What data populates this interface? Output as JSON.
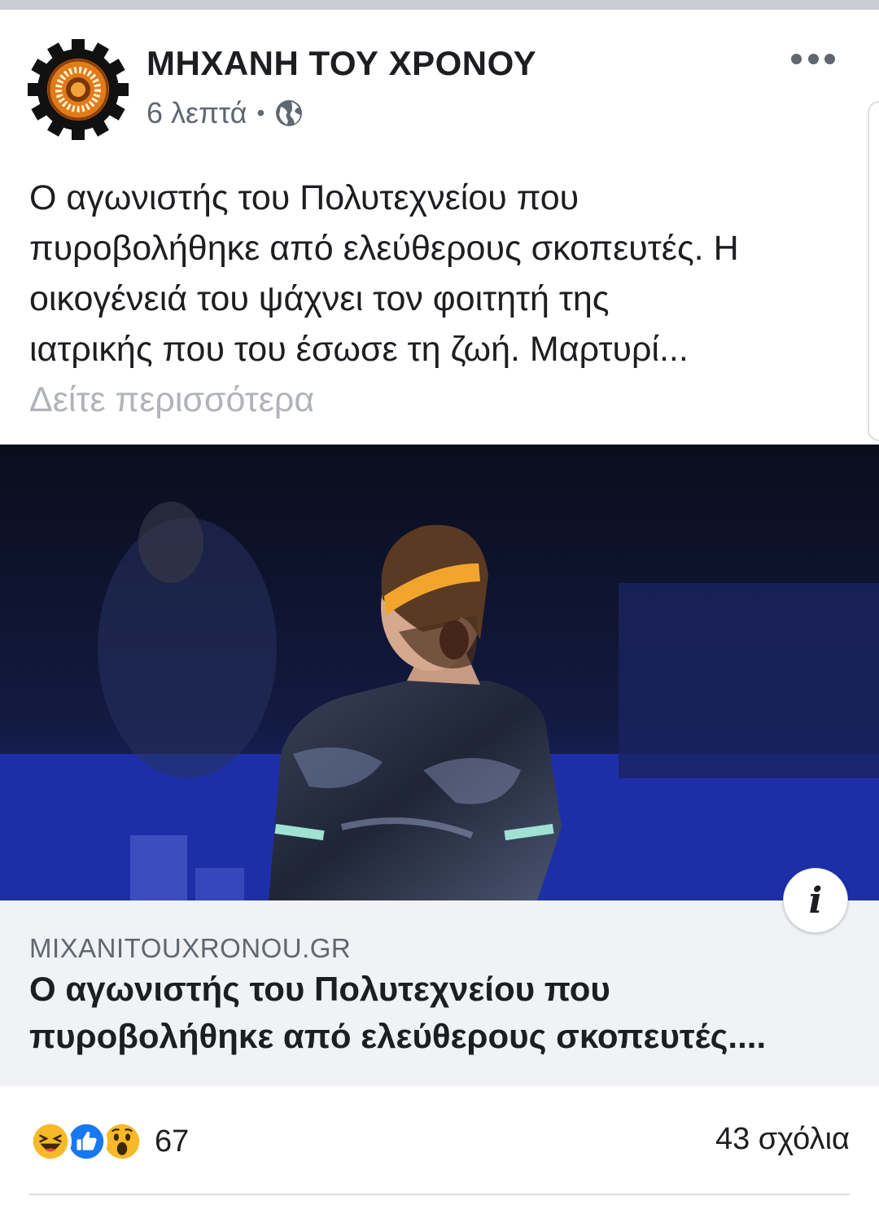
{
  "post": {
    "page_name": "ΜΗΧΑΝΗ ΤΟΥ ΧΡΟΝΟΥ",
    "time": "6 λεπτά",
    "separator": "•",
    "privacy_icon": "globe-icon",
    "text_lines": [
      "Ο αγωνιστής του Πολυτεχνείου που",
      "πυροβολήθηκε από ελεύθερους σκοπευτές. Η",
      "οικογένειά του ψάχνει τον φοιτητή της",
      "ιατρικής που του έσωσε τη ζωή. Μαρτυρί..."
    ],
    "see_more": "Δείτε περισσότερα"
  },
  "link_preview": {
    "domain": "MIXANITOUXRONOU.GR",
    "title_lines": [
      "Ο αγωνιστής του Πολυτεχνείου που",
      "πυροβολήθηκε από ελεύθερους σκοπευτές...."
    ],
    "info_label": "i"
  },
  "footer": {
    "reaction_icons": [
      "haha-icon",
      "like-icon",
      "wow-icon"
    ],
    "reaction_count": "67",
    "comments": "43 σχόλια"
  },
  "colors": {
    "text": "#1c1e21",
    "secondary": "#606770",
    "see_more": "#b0b3b8",
    "like_blue": "#1877f2",
    "emoji_yellow": "#f7b928",
    "link_bg": "#f0f2f5"
  }
}
